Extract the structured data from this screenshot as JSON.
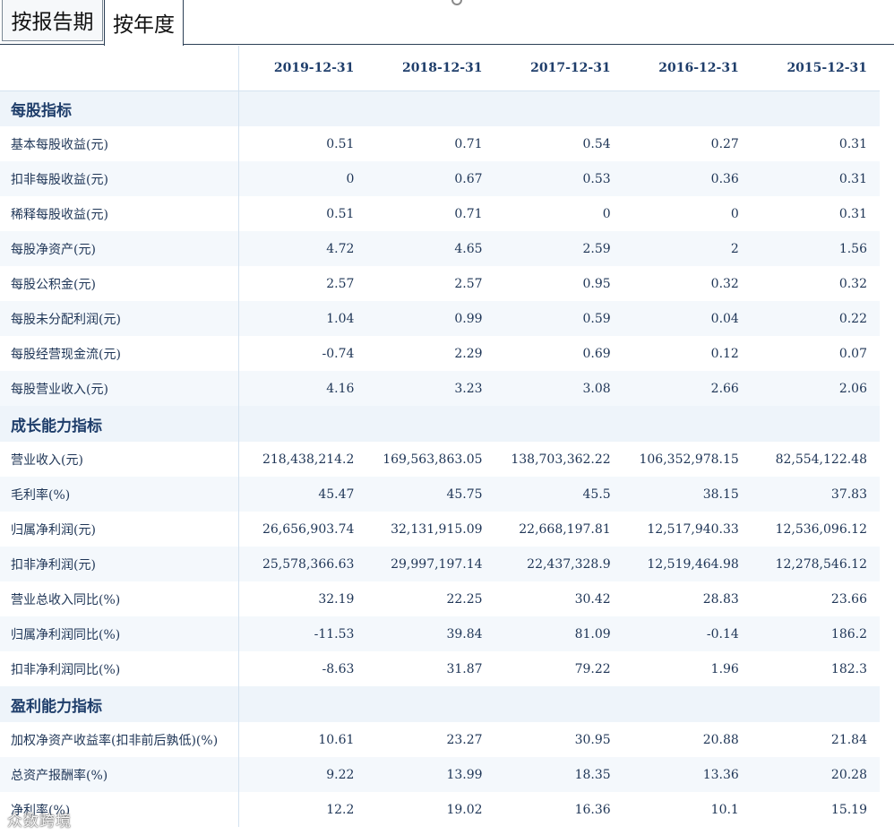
{
  "tabs": [
    {
      "label": "按报告期",
      "active": false
    },
    {
      "label": "按年度",
      "active": true
    }
  ],
  "table": {
    "header": [
      "",
      "2019-12-31",
      "2018-12-31",
      "2017-12-31",
      "2016-12-31",
      "2015-12-31"
    ],
    "sections": [
      {
        "title": "每股指标",
        "rows": [
          {
            "label": "基本每股收益(元)",
            "values": [
              "0.51",
              "0.71",
              "0.54",
              "0.27",
              "0.31"
            ]
          },
          {
            "label": "扣非每股收益(元)",
            "values": [
              "0",
              "0.67",
              "0.53",
              "0.36",
              "0.31"
            ]
          },
          {
            "label": "稀释每股收益(元)",
            "values": [
              "0.51",
              "0.71",
              "0",
              "0",
              "0.31"
            ]
          },
          {
            "label": "每股净资产(元)",
            "values": [
              "4.72",
              "4.65",
              "2.59",
              "2",
              "1.56"
            ]
          },
          {
            "label": "每股公积金(元)",
            "values": [
              "2.57",
              "2.57",
              "0.95",
              "0.32",
              "0.32"
            ]
          },
          {
            "label": "每股未分配利润(元)",
            "values": [
              "1.04",
              "0.99",
              "0.59",
              "0.04",
              "0.22"
            ]
          },
          {
            "label": "每股经营现金流(元)",
            "values": [
              "-0.74",
              "2.29",
              "0.69",
              "0.12",
              "0.07"
            ]
          },
          {
            "label": "每股营业收入(元)",
            "values": [
              "4.16",
              "3.23",
              "3.08",
              "2.66",
              "2.06"
            ]
          }
        ]
      },
      {
        "title": "成长能力指标",
        "rows": [
          {
            "label": "营业收入(元)",
            "values": [
              "218,438,214.2",
              "169,563,863.05",
              "138,703,362.22",
              "106,352,978.15",
              "82,554,122.48"
            ]
          },
          {
            "label": "毛利率(%)",
            "values": [
              "45.47",
              "45.75",
              "45.5",
              "38.15",
              "37.83"
            ]
          },
          {
            "label": "归属净利润(元)",
            "values": [
              "26,656,903.74",
              "32,131,915.09",
              "22,668,197.81",
              "12,517,940.33",
              "12,536,096.12"
            ]
          },
          {
            "label": "扣非净利润(元)",
            "values": [
              "25,578,366.63",
              "29,997,197.14",
              "22,437,328.9",
              "12,519,464.98",
              "12,278,546.12"
            ]
          },
          {
            "label": "营业总收入同比(%)",
            "values": [
              "32.19",
              "22.25",
              "30.42",
              "28.83",
              "23.66"
            ]
          },
          {
            "label": "归属净利润同比(%)",
            "values": [
              "-11.53",
              "39.84",
              "81.09",
              "-0.14",
              "186.2"
            ]
          },
          {
            "label": "扣非净利润同比(%)",
            "values": [
              "-8.63",
              "31.87",
              "79.22",
              "1.96",
              "182.3"
            ]
          }
        ]
      },
      {
        "title": "盈利能力指标",
        "rows": [
          {
            "label": "加权净资产收益率(扣非前后孰低)(%)",
            "values": [
              "10.61",
              "23.27",
              "30.95",
              "20.88",
              "21.84"
            ]
          },
          {
            "label": "总资产报酬率(%)",
            "values": [
              "9.22",
              "13.99",
              "18.35",
              "13.36",
              "20.28"
            ]
          },
          {
            "label": "净利率(%)",
            "values": [
              "12.2",
              "19.02",
              "16.36",
              "10.1",
              "15.19"
            ]
          }
        ]
      }
    ]
  },
  "watermark": "众数跨境"
}
